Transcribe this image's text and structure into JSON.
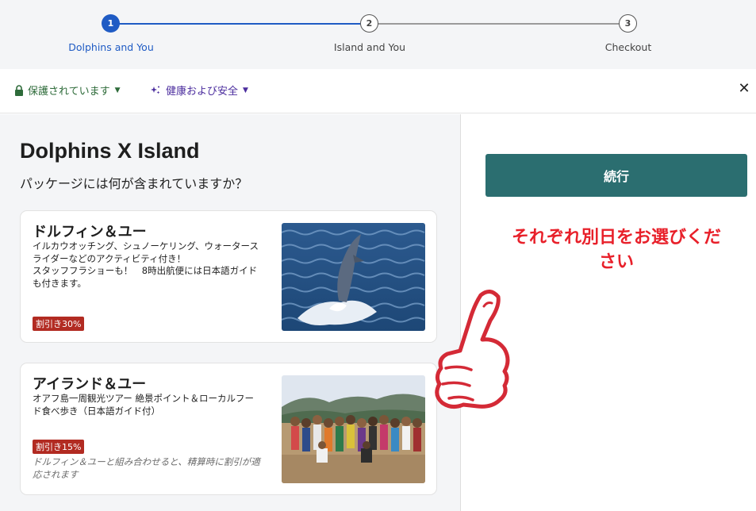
{
  "stepper": {
    "steps": [
      {
        "number": "1",
        "label": "Dolphins and You",
        "state": "active"
      },
      {
        "number": "2",
        "label": "Island and You",
        "state": "idle"
      },
      {
        "number": "3",
        "label": "Checkout",
        "state": "idle"
      }
    ],
    "accent_color": "#1f5bc4"
  },
  "secbar": {
    "protected_label": "保護されています",
    "health_label": "健康および安全",
    "close_symbol": "✕"
  },
  "main": {
    "title": "Dolphins X Island",
    "subtitle": "パッケージには何が含まれていますか？",
    "packages": [
      {
        "title": "ドルフィン＆ユー",
        "description": "イルカウオッチング、シュノーケリング、ウォータースライダーなどのアクティビティ付き！\nスタッフフラショーも！　8時出航便には日本語ガイドも付きます。",
        "badge": "割引き30%",
        "note": "",
        "image": "dolphin-jumping-photo"
      },
      {
        "title": "アイランド＆ユー",
        "description": "オアフ島一周観光ツアー 絶景ポイント＆ローカルフード食べ歩き（日本語ガイド付）",
        "badge": "割引き15%",
        "note": "ドルフィン＆ユーと組み合わせると、精算時に割引が適応されます",
        "image": "tour-group-photo"
      }
    ]
  },
  "sidebar": {
    "continue_label": "続行",
    "annotation": "それぞれ別日をお選びください",
    "button_color": "#2b6e70",
    "annotation_color": "#e8202a"
  }
}
